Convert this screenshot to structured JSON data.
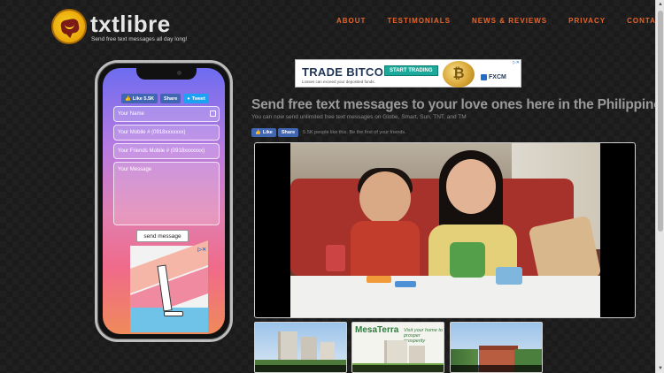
{
  "site": {
    "name": "txtlibre",
    "tagline": "Send free text messages all day long!"
  },
  "nav": {
    "items": [
      "ABOUT",
      "TESTIMONIALS",
      "NEWS & REVIEWS",
      "PRIVACY",
      "CONTACT"
    ]
  },
  "phone_form": {
    "like_label": "Like 5.5K",
    "share_label": "Share",
    "tweet_label": "Tweet",
    "name_placeholder": "Your Name",
    "mobile_placeholder": "Your Mobile # (0918xxxxxxx)",
    "friend_placeholder": "Your Friends Mobile # (0918xxxxxxx)",
    "message_placeholder": "Your Message",
    "send_label": "send message"
  },
  "banner_ad": {
    "title": "TRADE BITCOIN",
    "cta": "START TRADING",
    "disclaimer": "Losses can exceed your deposited funds.",
    "brand": "FXCM",
    "coin_symbol": "₿"
  },
  "main": {
    "headline": "Send free text messages to your love ones here in the Philippines!",
    "subline": "You can now send unlimited free text messages on Globe, Smart, Sun, TNT, and TM",
    "like_label": "Like",
    "share_label": "Share",
    "like_text": "5.5K people like this. Be the first of your friends."
  },
  "thumbnails": {
    "t2_brand": "MesaTerra",
    "t2_tagline": "Visit your home to prosper prosperity"
  },
  "colors": {
    "accent": "#e6642a",
    "facebook": "#4267b2",
    "twitter": "#1da1f2"
  }
}
